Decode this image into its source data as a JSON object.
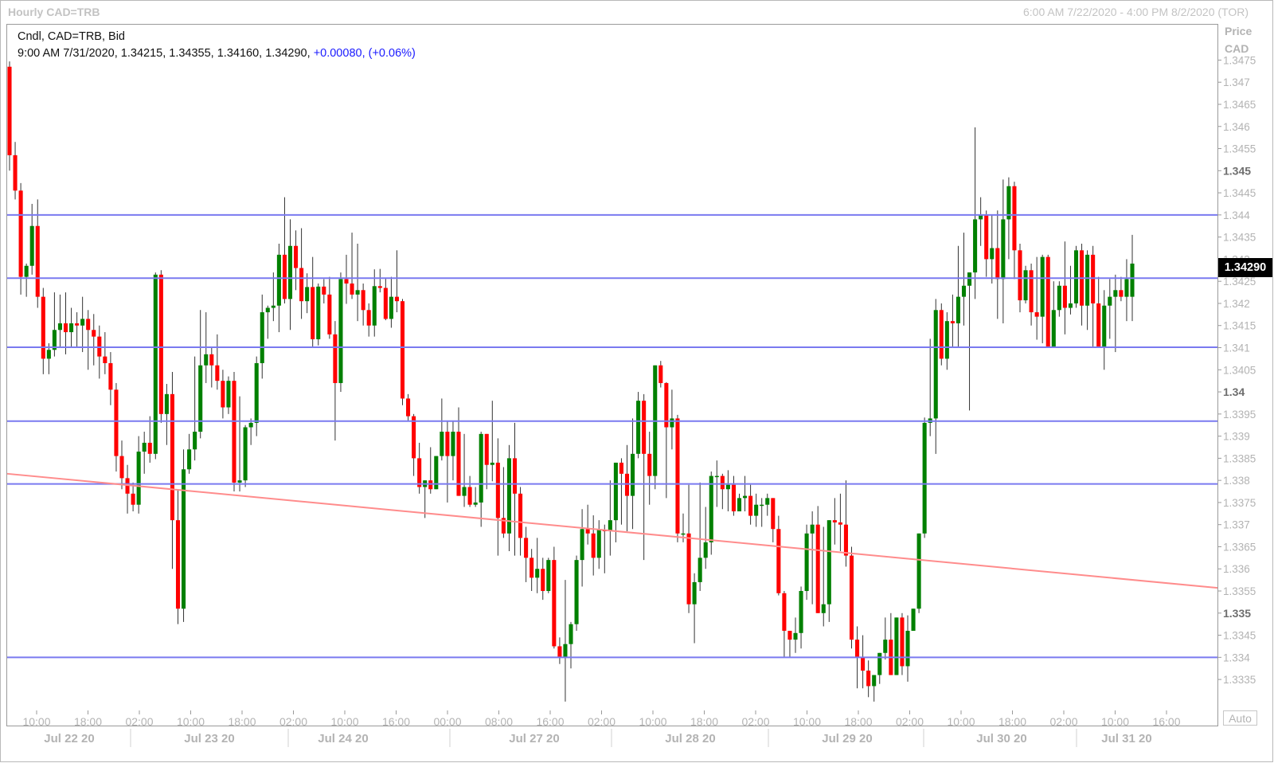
{
  "header": {
    "title_left": "Hourly CAD=TRB",
    "title_right": "6:00 AM 7/22/2020 - 4:00 PM 8/2/2020 (TOR)"
  },
  "info": {
    "line1": "Cndl, CAD=TRB, Bid",
    "line2_prefix": "9:00 AM 7/31/2020, 1.34215, 1.34355, 1.34160, 1.34290,",
    "change": "+0.00080, (+0.06%)"
  },
  "axis": {
    "head_line1": "Price",
    "head_line2": "CAD",
    "auto_label": "Auto",
    "last_price": "1.34290"
  },
  "colors": {
    "up": "#008000",
    "down": "#ff0000",
    "hline": "#7a7af0",
    "trend": "#ff8c8c"
  },
  "chart_data": {
    "type": "candlestick",
    "title": "Hourly CAD=TRB",
    "ylabel": "Price CAD",
    "ylim": [
      1.3328,
      1.3483
    ],
    "y_ticks": [
      "1.3475",
      "1.347",
      "1.3465",
      "1.346",
      "1.3455",
      "1.345",
      "1.3445",
      "1.344",
      "1.3435",
      "1.343",
      "1.3425",
      "1.342",
      "1.3415",
      "1.341",
      "1.3405",
      "1.34",
      "1.3395",
      "1.339",
      "1.3385",
      "1.338",
      "1.3375",
      "1.337",
      "1.3365",
      "1.336",
      "1.3355",
      "1.335",
      "1.3345",
      "1.334",
      "1.3335"
    ],
    "y_major": [
      "1.345",
      "1.34",
      "1.335"
    ],
    "x_time_labels": [
      "10:00",
      "18:00",
      "02:00",
      "10:00",
      "18:00",
      "02:00",
      "10:00",
      "16:00",
      "00:00",
      "08:00",
      "16:00",
      "02:00",
      "10:00",
      "18:00",
      "02:00",
      "10:00",
      "18:00",
      "02:00",
      "10:00",
      "18:00",
      "02:00",
      "10:00",
      "16:00"
    ],
    "x_date_labels": [
      "Jul 22 20",
      "Jul 23 20",
      "Jul 24 20",
      "Jul 27 20",
      "Jul 28 20",
      "Jul 29 20",
      "Jul 30 20",
      "Jul 31 20"
    ],
    "horizontal_lines": [
      1.344,
      1.34257,
      1.34101,
      1.33934,
      1.33792,
      1.334
    ],
    "trendline": {
      "start": 1.33815,
      "end": 1.33557
    },
    "candles": [
      [
        1.34735,
        1.34747,
        1.345,
        1.34535
      ],
      [
        1.34535,
        1.34565,
        1.34435,
        1.34455
      ],
      [
        1.34455,
        1.34472,
        1.3422,
        1.3426
      ],
      [
        1.3426,
        1.3429,
        1.34215,
        1.34285
      ],
      [
        1.34285,
        1.34425,
        1.34265,
        1.34375
      ],
      [
        1.34375,
        1.34435,
        1.3419,
        1.34215
      ],
      [
        1.34215,
        1.34235,
        1.3404,
        1.34075
      ],
      [
        1.34075,
        1.3411,
        1.3404,
        1.34095
      ],
      [
        1.34095,
        1.34225,
        1.3408,
        1.3414
      ],
      [
        1.3414,
        1.3422,
        1.341,
        1.34155
      ],
      [
        1.34155,
        1.34225,
        1.34085,
        1.34135
      ],
      [
        1.34135,
        1.3419,
        1.341,
        1.34155
      ],
      [
        1.34155,
        1.3418,
        1.341,
        1.3415
      ],
      [
        1.3415,
        1.34215,
        1.3409,
        1.34165
      ],
      [
        1.34165,
        1.34185,
        1.3405,
        1.3414
      ],
      [
        1.3414,
        1.34176,
        1.3406,
        1.34125
      ],
      [
        1.34125,
        1.3415,
        1.3403,
        1.3408
      ],
      [
        1.3408,
        1.34135,
        1.3404,
        1.34065
      ],
      [
        1.34065,
        1.3409,
        1.3397,
        1.34005
      ],
      [
        1.34005,
        1.3402,
        1.3382,
        1.33855
      ],
      [
        1.33855,
        1.3389,
        1.3378,
        1.33805
      ],
      [
        1.33805,
        1.33835,
        1.33725,
        1.3377
      ],
      [
        1.3377,
        1.33795,
        1.3373,
        1.33745
      ],
      [
        1.33745,
        1.339,
        1.33725,
        1.33865
      ],
      [
        1.33865,
        1.3391,
        1.33815,
        1.33885
      ],
      [
        1.33885,
        1.33945,
        1.3384,
        1.3386
      ],
      [
        1.3386,
        1.3427,
        1.33848,
        1.34265
      ],
      [
        1.34265,
        1.34275,
        1.3393,
        1.3395
      ],
      [
        1.3395,
        1.34018,
        1.3388,
        1.33995
      ],
      [
        1.33995,
        1.34045,
        1.336,
        1.3371
      ],
      [
        1.3371,
        1.3378,
        1.33475,
        1.3351
      ],
      [
        1.3351,
        1.3387,
        1.3348,
        1.33825
      ],
      [
        1.33825,
        1.33905,
        1.33815,
        1.3387
      ],
      [
        1.3387,
        1.3408,
        1.33845,
        1.3391
      ],
      [
        1.3391,
        1.34185,
        1.33895,
        1.3406
      ],
      [
        1.3406,
        1.3418,
        1.3402,
        1.34085
      ],
      [
        1.34085,
        1.341,
        1.3401,
        1.3406
      ],
      [
        1.3406,
        1.3413,
        1.34005,
        1.34025
      ],
      [
        1.34025,
        1.3405,
        1.3394,
        1.33965
      ],
      [
        1.33965,
        1.34035,
        1.3395,
        1.34025
      ],
      [
        1.34025,
        1.34045,
        1.33775,
        1.33795
      ],
      [
        1.33795,
        1.3399,
        1.33775,
        1.338
      ],
      [
        1.338,
        1.33925,
        1.33785,
        1.3392
      ],
      [
        1.3392,
        1.3394,
        1.3388,
        1.3393
      ],
      [
        1.3393,
        1.3408,
        1.339,
        1.34065
      ],
      [
        1.34065,
        1.3422,
        1.3403,
        1.3418
      ],
      [
        1.3418,
        1.34195,
        1.3412,
        1.3419
      ],
      [
        1.3419,
        1.3427,
        1.3416,
        1.34195
      ],
      [
        1.34195,
        1.34335,
        1.34135,
        1.3431
      ],
      [
        1.3431,
        1.3444,
        1.342,
        1.3421
      ],
      [
        1.3421,
        1.3439,
        1.3414,
        1.3433
      ],
      [
        1.3433,
        1.34365,
        1.3423,
        1.3428
      ],
      [
        1.3428,
        1.3437,
        1.34165,
        1.34205
      ],
      [
        1.34205,
        1.34268,
        1.34178,
        1.34237
      ],
      [
        1.34237,
        1.34305,
        1.341,
        1.34119
      ],
      [
        1.34119,
        1.34245,
        1.34105,
        1.34238
      ],
      [
        1.34238,
        1.34255,
        1.342,
        1.3422
      ],
      [
        1.3422,
        1.3426,
        1.3412,
        1.3413
      ],
      [
        1.3413,
        1.3416,
        1.3389,
        1.3402
      ],
      [
        1.3402,
        1.3427,
        1.34,
        1.34255
      ],
      [
        1.34255,
        1.3431,
        1.34199,
        1.34245
      ],
      [
        1.34245,
        1.3436,
        1.3421,
        1.3422
      ],
      [
        1.3422,
        1.34335,
        1.3416,
        1.3423
      ],
      [
        1.3423,
        1.34245,
        1.3415,
        1.34185
      ],
      [
        1.34185,
        1.342,
        1.34125,
        1.3415
      ],
      [
        1.3415,
        1.34277,
        1.34125,
        1.34239
      ],
      [
        1.34239,
        1.34278,
        1.34225,
        1.34235
      ],
      [
        1.34235,
        1.34258,
        1.34162,
        1.34165
      ],
      [
        1.34165,
        1.3426,
        1.34145,
        1.34215
      ],
      [
        1.34215,
        1.3432,
        1.3418,
        1.34205
      ],
      [
        1.34205,
        1.3421,
        1.3397,
        1.33985
      ],
      [
        1.33985,
        1.33995,
        1.33935,
        1.33945
      ],
      [
        1.33945,
        1.3395,
        1.3381,
        1.3385
      ],
      [
        1.3385,
        1.33885,
        1.3377,
        1.33785
      ],
      [
        1.33785,
        1.338,
        1.33715,
        1.338
      ],
      [
        1.338,
        1.33875,
        1.3377,
        1.3378
      ],
      [
        1.3378,
        1.3383,
        1.33785,
        1.33855
      ],
      [
        1.33855,
        1.33985,
        1.33845,
        1.3391
      ],
      [
        1.3391,
        1.33935,
        1.3375,
        1.33855
      ],
      [
        1.33855,
        1.33935,
        1.338,
        1.3391
      ],
      [
        1.3391,
        1.33965,
        1.33765,
        1.33765
      ],
      [
        1.33765,
        1.33905,
        1.3374,
        1.33785
      ],
      [
        1.33785,
        1.3381,
        1.3374,
        1.33745
      ],
      [
        1.33745,
        1.33785,
        1.3374,
        1.3375
      ],
      [
        1.3375,
        1.3391,
        1.33695,
        1.33905
      ],
      [
        1.33905,
        1.339,
        1.3378,
        1.33835
      ],
      [
        1.33835,
        1.3398,
        1.33798,
        1.3384
      ],
      [
        1.3384,
        1.33895,
        1.3363,
        1.33715
      ],
      [
        1.33715,
        1.3383,
        1.3367,
        1.3368
      ],
      [
        1.3368,
        1.3388,
        1.3364,
        1.3385
      ],
      [
        1.3385,
        1.3393,
        1.3363,
        1.3377
      ],
      [
        1.3377,
        1.33785,
        1.3363,
        1.3367
      ],
      [
        1.3367,
        1.33695,
        1.3357,
        1.33625
      ],
      [
        1.33625,
        1.33645,
        1.3355,
        1.3358
      ],
      [
        1.3358,
        1.3367,
        1.33545,
        1.336
      ],
      [
        1.336,
        1.33625,
        1.3353,
        1.3355
      ],
      [
        1.3355,
        1.33625,
        1.33545,
        1.3362
      ],
      [
        1.3362,
        1.3365,
        1.3342,
        1.33425
      ],
      [
        1.33425,
        1.33445,
        1.33385,
        1.334
      ],
      [
        1.334,
        1.33575,
        1.333,
        1.3343
      ],
      [
        1.3343,
        1.3348,
        1.33375,
        1.33475
      ],
      [
        1.33475,
        1.3363,
        1.3346,
        1.3362
      ],
      [
        1.3362,
        1.33735,
        1.3356,
        1.3369
      ],
      [
        1.3369,
        1.33745,
        1.33655,
        1.3368
      ],
      [
        1.3368,
        1.33721,
        1.33585,
        1.33625
      ],
      [
        1.33625,
        1.3371,
        1.336,
        1.33688
      ],
      [
        1.33688,
        1.337,
        1.3359,
        1.33685
      ],
      [
        1.33685,
        1.338,
        1.3363,
        1.3371
      ],
      [
        1.3371,
        1.33832,
        1.3366,
        1.3384
      ],
      [
        1.3384,
        1.3385,
        1.337,
        1.33815
      ],
      [
        1.33815,
        1.3388,
        1.33685,
        1.33765
      ],
      [
        1.33765,
        1.3394,
        1.3369,
        1.3386
      ],
      [
        1.3386,
        1.34,
        1.3385,
        1.3398
      ],
      [
        1.3398,
        1.33995,
        1.3362,
        1.3386
      ],
      [
        1.3386,
        1.3391,
        1.33745,
        1.3381
      ],
      [
        1.3381,
        1.3404,
        1.3378,
        1.3406
      ],
      [
        1.3406,
        1.3407,
        1.3401,
        1.3402
      ],
      [
        1.3402,
        1.34022,
        1.3376,
        1.3392
      ],
      [
        1.3392,
        1.34005,
        1.3387,
        1.3394
      ],
      [
        1.3394,
        1.33948,
        1.3366,
        1.3368
      ],
      [
        1.3368,
        1.33725,
        1.3366,
        1.3368
      ],
      [
        1.3368,
        1.3379,
        1.335,
        1.3352
      ],
      [
        1.3352,
        1.3359,
        1.33432,
        1.3357
      ],
      [
        1.3357,
        1.33795,
        1.3355,
        1.33625
      ],
      [
        1.33625,
        1.3374,
        1.336,
        1.3366
      ],
      [
        1.3366,
        1.3382,
        1.33632,
        1.3381
      ],
      [
        1.3381,
        1.33845,
        1.3374,
        1.3381
      ],
      [
        1.3381,
        1.33815,
        1.33735,
        1.3378
      ],
      [
        1.3378,
        1.33823,
        1.3373,
        1.3379
      ],
      [
        1.3379,
        1.3381,
        1.3372,
        1.3373
      ],
      [
        1.3373,
        1.3377,
        1.3374,
        1.3376
      ],
      [
        1.3376,
        1.3381,
        1.3373,
        1.33765
      ],
      [
        1.33765,
        1.3379,
        1.337,
        1.3372
      ],
      [
        1.3372,
        1.3377,
        1.33695,
        1.33745
      ],
      [
        1.33745,
        1.3376,
        1.33695,
        1.33745
      ],
      [
        1.33745,
        1.3377,
        1.3372,
        1.3376
      ],
      [
        1.3376,
        1.3374,
        1.3366,
        1.3369
      ],
      [
        1.3369,
        1.3372,
        1.3354,
        1.33545
      ],
      [
        1.33545,
        1.3355,
        1.334,
        1.3346
      ],
      [
        1.3346,
        1.3346,
        1.334,
        1.3344
      ],
      [
        1.3344,
        1.3349,
        1.3341,
        1.33455
      ],
      [
        1.33455,
        1.3356,
        1.3342,
        1.3355
      ],
      [
        1.3355,
        1.337,
        1.3353,
        1.3368
      ],
      [
        1.3368,
        1.3373,
        1.3352,
        1.337
      ],
      [
        1.337,
        1.33742,
        1.33605,
        1.335
      ],
      [
        1.335,
        1.33695,
        1.3347,
        1.3352
      ],
      [
        1.3352,
        1.3367,
        1.3348,
        1.3371
      ],
      [
        1.3371,
        1.3376,
        1.33655,
        1.33705
      ],
      [
        1.33705,
        1.3377,
        1.3364,
        1.337
      ],
      [
        1.337,
        1.338,
        1.33605,
        1.3363
      ],
      [
        1.3363,
        1.3365,
        1.3342,
        1.3344
      ],
      [
        1.3344,
        1.3347,
        1.3333,
        1.334
      ],
      [
        1.334,
        1.3345,
        1.3333,
        1.3337
      ],
      [
        1.3337,
        1.33393,
        1.3331,
        1.33335
      ],
      [
        1.33335,
        1.3336,
        1.333,
        1.3336
      ],
      [
        1.3336,
        1.3338,
        1.3334,
        1.3341
      ],
      [
        1.3341,
        1.3349,
        1.33395,
        1.3344
      ],
      [
        1.3344,
        1.335,
        1.334,
        1.3336
      ],
      [
        1.3336,
        1.3349,
        1.334,
        1.3349
      ],
      [
        1.3349,
        1.335,
        1.3336,
        1.3338
      ],
      [
        1.3338,
        1.33495,
        1.33345,
        1.3346
      ],
      [
        1.3346,
        1.3351,
        1.335,
        1.3351
      ],
      [
        1.3351,
        1.3368,
        1.335,
        1.3368
      ],
      [
        1.3368,
        1.33942,
        1.3367,
        1.3393
      ],
      [
        1.3393,
        1.3412,
        1.339,
        1.3394
      ],
      [
        1.3394,
        1.3421,
        1.3386,
        1.34185
      ],
      [
        1.34185,
        1.342,
        1.3406,
        1.34075
      ],
      [
        1.34075,
        1.3418,
        1.3405,
        1.3416
      ],
      [
        1.3416,
        1.3422,
        1.341,
        1.34155
      ],
      [
        1.34155,
        1.3433,
        1.341,
        1.34215
      ],
      [
        1.34215,
        1.3436,
        1.3415,
        1.3424
      ],
      [
        1.3424,
        1.34255,
        1.33958,
        1.3427
      ],
      [
        1.3427,
        1.34598,
        1.3421,
        1.3439
      ],
      [
        1.3439,
        1.3444,
        1.3433,
        1.344
      ],
      [
        1.344,
        1.3441,
        1.3426,
        1.343
      ],
      [
        1.343,
        1.344,
        1.34245,
        1.34325
      ],
      [
        1.34325,
        1.3441,
        1.34165,
        1.34255
      ],
      [
        1.34255,
        1.3448,
        1.34155,
        1.3439
      ],
      [
        1.3439,
        1.34485,
        1.343,
        1.34465
      ],
      [
        1.34465,
        1.34475,
        1.34255,
        1.3432
      ],
      [
        1.3432,
        1.34335,
        1.3418,
        1.34207
      ],
      [
        1.34207,
        1.34285,
        1.342,
        1.34275
      ],
      [
        1.34275,
        1.3429,
        1.3415,
        1.3418
      ],
      [
        1.3418,
        1.34305,
        1.34118,
        1.3417
      ],
      [
        1.3417,
        1.3431,
        1.3411,
        1.34305
      ],
      [
        1.34305,
        1.3431,
        1.341,
        1.341
      ],
      [
        1.341,
        1.3425,
        1.3413,
        1.34185
      ],
      [
        1.34185,
        1.3425,
        1.3417,
        1.3424
      ],
      [
        1.3424,
        1.3434,
        1.3413,
        1.3419
      ],
      [
        1.3419,
        1.34285,
        1.34175,
        1.342
      ],
      [
        1.342,
        1.3433,
        1.3419,
        1.3432
      ],
      [
        1.3432,
        1.34335,
        1.3415,
        1.34195
      ],
      [
        1.34195,
        1.3432,
        1.3414,
        1.3431
      ],
      [
        1.3431,
        1.3433,
        1.341,
        1.342
      ],
      [
        1.342,
        1.3426,
        1.341,
        1.341
      ],
      [
        1.341,
        1.3423,
        1.3405,
        1.34195
      ],
      [
        1.34195,
        1.34255,
        1.3412,
        1.34215
      ],
      [
        1.34215,
        1.34265,
        1.3409,
        1.3423
      ],
      [
        1.3423,
        1.3426,
        1.34205,
        1.34215
      ],
      [
        1.34215,
        1.343,
        1.3416,
        1.34255
      ],
      [
        1.34215,
        1.34355,
        1.3416,
        1.3429
      ]
    ]
  }
}
